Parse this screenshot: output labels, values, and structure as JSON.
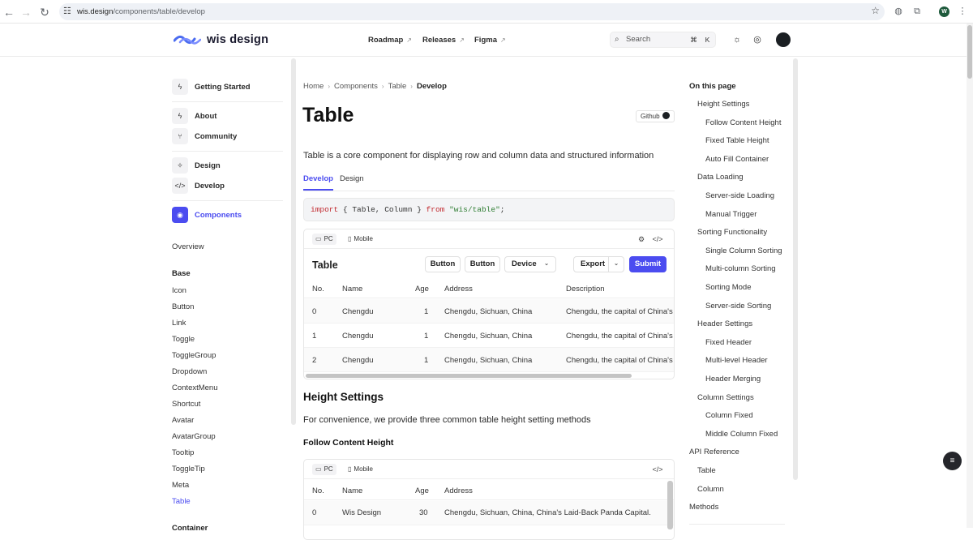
{
  "browser": {
    "url_host": "wis.design",
    "url_path": "/components/table/develop",
    "profile_initial": "W"
  },
  "header": {
    "logo_text": "wis design",
    "nav": [
      "Roadmap",
      "Releases",
      "Figma"
    ],
    "search_placeholder": "Search",
    "kbd": [
      "⌘",
      "K"
    ]
  },
  "sidebar": {
    "top": [
      {
        "label": "Getting Started",
        "icon": "lightning-icon"
      },
      {
        "label": "About",
        "icon": "lightning-icon"
      },
      {
        "label": "Community",
        "icon": "git-branch-icon"
      },
      {
        "label": "Design",
        "icon": "sparkle-icon"
      },
      {
        "label": "Develop",
        "icon": "code-icon"
      },
      {
        "label": "Components",
        "icon": "component-icon",
        "active": true
      }
    ],
    "overview": "Overview",
    "base_heading": "Base",
    "base_items": [
      "Icon",
      "Button",
      "Link",
      "Toggle",
      "ToggleGroup",
      "Dropdown",
      "ContextMenu",
      "Shortcut",
      "Avatar",
      "AvatarGroup",
      "Tooltip",
      "ToggleTip",
      "Meta",
      "Table"
    ],
    "active_item": "Table",
    "container_heading": "Container"
  },
  "main": {
    "breadcrumb": [
      "Home",
      "Components",
      "Table",
      "Develop"
    ],
    "title": "Table",
    "github_label": "Github",
    "lead": "Table is a core component for displaying row and column data and structured information",
    "tabs": [
      "Develop",
      "Design"
    ],
    "code": {
      "kw1": "import",
      "mid": " { Table, Column } ",
      "kw2": "from",
      "str": "\"wis/table\"",
      "end": ";"
    },
    "demo1": {
      "device_tabs": [
        "PC",
        "Mobile"
      ],
      "table_title": "Table",
      "buttons": [
        "Button",
        "Button",
        "Device",
        "Export",
        "Submit"
      ],
      "columns": [
        "No.",
        "Name",
        "Age",
        "Address",
        "Description"
      ],
      "rows": [
        {
          "no": "0",
          "name": "Chengdu",
          "age": "1",
          "address": "Chengdu, Sichuan, China",
          "desc": "Chengdu, the capital of China's S"
        },
        {
          "no": "1",
          "name": "Chengdu",
          "age": "1",
          "address": "Chengdu, Sichuan, China",
          "desc": "Chengdu, the capital of China's S"
        },
        {
          "no": "2",
          "name": "Chengdu",
          "age": "1",
          "address": "Chengdu, Sichuan, China",
          "desc": "Chengdu, the capital of China's S"
        }
      ]
    },
    "section1_title": "Height Settings",
    "section1_text": "For convenience, we provide three common table height setting methods",
    "sub1_title": "Follow Content Height",
    "demo2": {
      "device_tabs": [
        "PC",
        "Mobile"
      ],
      "columns": [
        "No.",
        "Name",
        "Age",
        "Address"
      ],
      "rows": [
        {
          "no": "0",
          "name": "Wis Design",
          "age": "30",
          "address": "Chengdu, Sichuan, China, China's Laid-Back Panda Capital."
        }
      ]
    }
  },
  "toc": {
    "title": "On this page",
    "items": [
      {
        "label": "Height Settings",
        "level": 1
      },
      {
        "label": "Follow Content Height",
        "level": 2
      },
      {
        "label": "Fixed Table Height",
        "level": 2
      },
      {
        "label": "Auto Fill Container",
        "level": 2
      },
      {
        "label": "Data Loading",
        "level": 1
      },
      {
        "label": "Server-side Loading",
        "level": 2
      },
      {
        "label": "Manual Trigger",
        "level": 2
      },
      {
        "label": "Sorting Functionality",
        "level": 1
      },
      {
        "label": "Single Column Sorting",
        "level": 2
      },
      {
        "label": "Multi-column Sorting",
        "level": 2
      },
      {
        "label": "Sorting Mode",
        "level": 2
      },
      {
        "label": "Server-side Sorting",
        "level": 2
      },
      {
        "label": "Header Settings",
        "level": 1
      },
      {
        "label": "Fixed Header",
        "level": 2
      },
      {
        "label": "Multi-level Header",
        "level": 2
      },
      {
        "label": "Header Merging",
        "level": 2
      },
      {
        "label": "Column Settings",
        "level": 1
      },
      {
        "label": "Column Fixed",
        "level": 2
      },
      {
        "label": "Middle Column Fixed",
        "level": 2
      },
      {
        "label": "API Reference",
        "level": 0
      },
      {
        "label": "Table",
        "level": 1
      },
      {
        "label": "Column",
        "level": 1
      },
      {
        "label": "Methods",
        "level": 0
      }
    ]
  },
  "colors": {
    "accent": "#4b4cf0",
    "text": "#1f1f1f"
  }
}
